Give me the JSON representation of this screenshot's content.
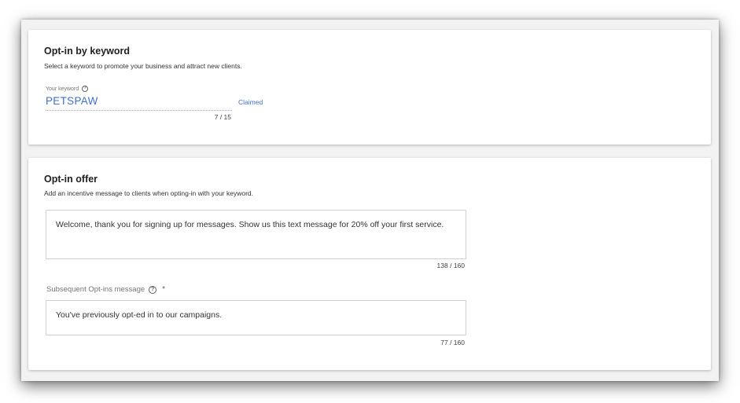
{
  "keyword_card": {
    "title": "Opt-in by keyword",
    "subtitle": "Select a keyword to promote your business and attract new clients.",
    "field_label": "Your keyword",
    "keyword_value": "PETSPAW",
    "status": "Claimed",
    "char_count": "7 / 15",
    "help_icon": "question-circle-icon"
  },
  "offer_card": {
    "title": "Opt-in offer",
    "subtitle": "Add an incentive message to clients when opting-in with your keyword.",
    "offer_message": "Welcome, thank you for signing up for messages.  Show us this text message for 20% off your first service.",
    "offer_count": "138 / 160",
    "subsequent_label": "Subsequent Opt-ins message",
    "required_mark": "*",
    "subsequent_message": "You've previously opt-ed in to our campaigns.",
    "subsequent_count": "77 / 160",
    "help_icon": "question-circle-icon"
  },
  "colors": {
    "accent": "#3f6fd8",
    "background": "#f2f2f2",
    "card": "#ffffff"
  }
}
